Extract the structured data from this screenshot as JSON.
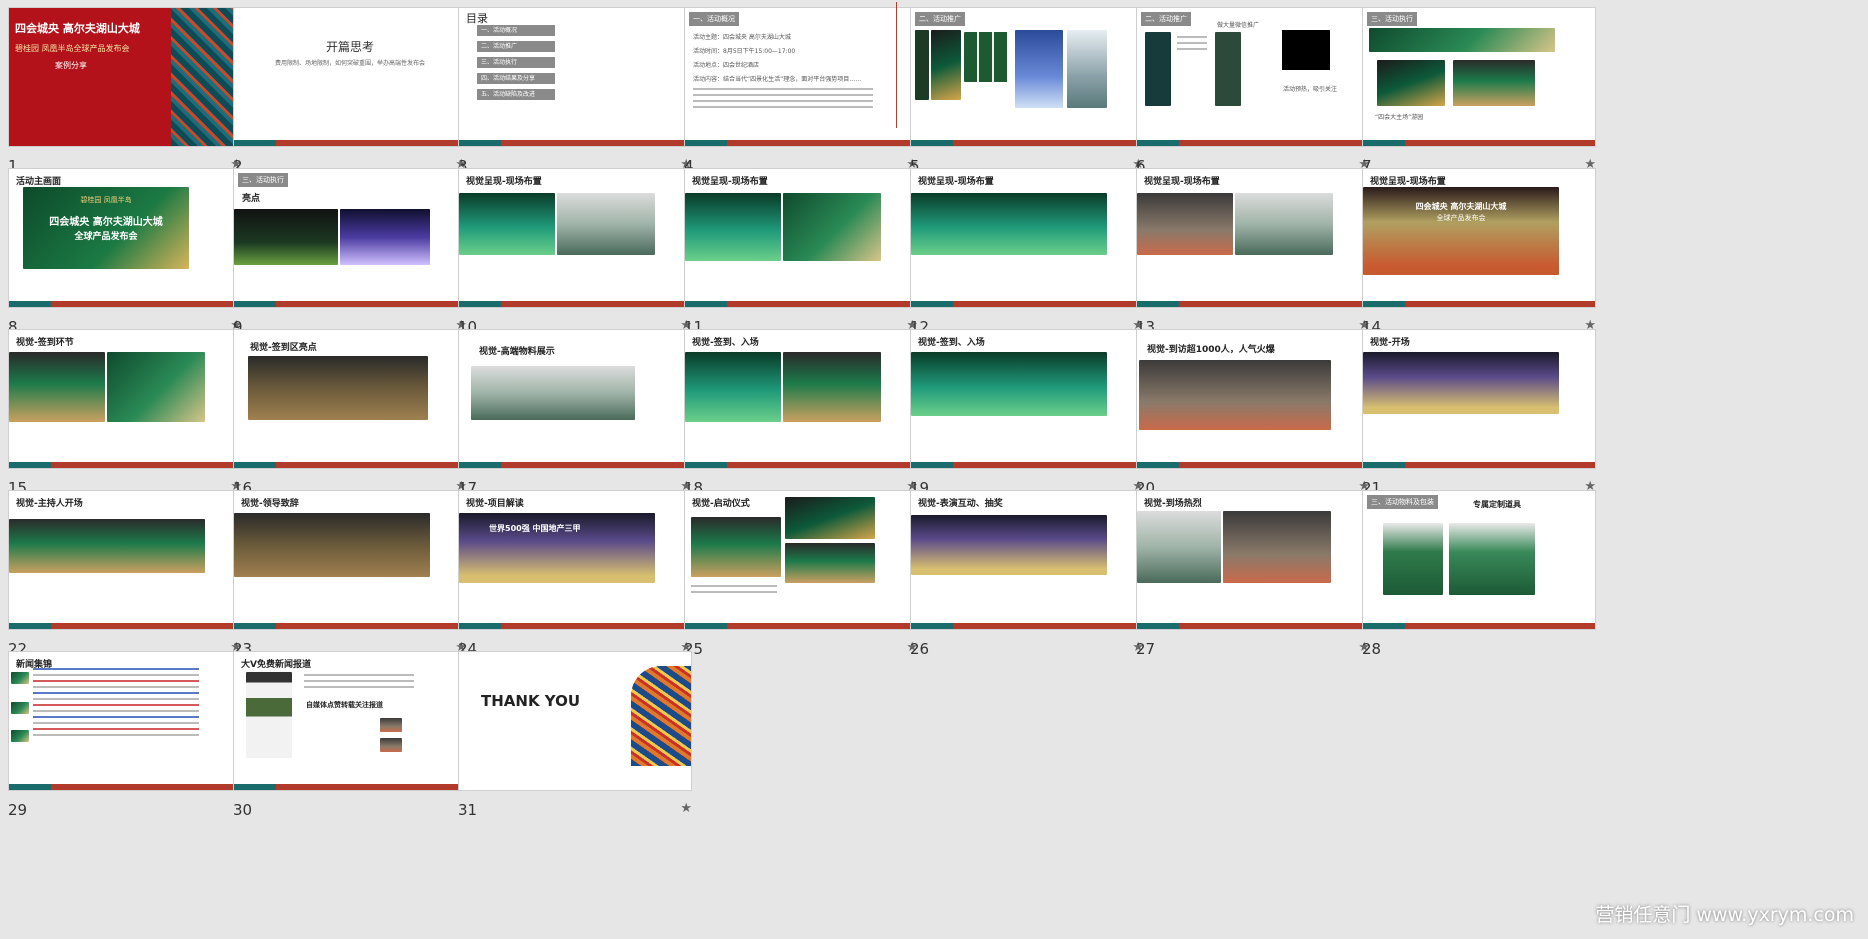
{
  "slides": [
    {
      "num": "1",
      "lines": [
        "四会城央 高尔夫湖山大城",
        "碧桂园 凤凰半岛全球产品发布会",
        "案例分享"
      ]
    },
    {
      "num": "2",
      "title": "开篇思考",
      "subtitle": "费用限制、场地限制，如何突破重围，举办高端性发布会"
    },
    {
      "num": "3",
      "title": "目录",
      "toc": [
        "一、活动概况",
        "二、活动推广",
        "三、活动执行",
        "四、活动结果及分享",
        "五、活动缺陷及改进"
      ]
    },
    {
      "num": "4",
      "label": "一、活动概况",
      "rows": [
        "活动主题：四会城央 高尔夫湖山大城",
        "活动时间：8月5日下午15:00—17:00",
        "活动地点：四会世纪酒店",
        "活动内容：结合当代“四景化生活”理念，面对平台强势项目……"
      ]
    },
    {
      "num": "5",
      "label": "二、活动推广"
    },
    {
      "num": "6",
      "label": "二、活动推广",
      "note": "做大量微信推广",
      "footer": "活动预热，吸引关注"
    },
    {
      "num": "7",
      "label": "三、活动执行",
      "footer": "“四会大主场”游园"
    },
    {
      "num": "8",
      "title": "活动主画面",
      "lines": [
        "碧桂园 凤凰半岛",
        "四会城央 高尔夫湖山大城",
        "全球产品发布会"
      ]
    },
    {
      "num": "9",
      "label": "三、活动执行",
      "title": "亮点"
    },
    {
      "num": "10",
      "title": "视觉呈现-现场布置"
    },
    {
      "num": "11",
      "title": "视觉呈现-现场布置"
    },
    {
      "num": "12",
      "title": "视觉呈现-现场布置"
    },
    {
      "num": "13",
      "title": "视觉呈现-现场布置"
    },
    {
      "num": "14",
      "title": "视觉呈现-现场布置",
      "lines": [
        "四会城央 高尔夫湖山大城",
        "全球产品发布会"
      ]
    },
    {
      "num": "15",
      "title": "视觉-签到环节"
    },
    {
      "num": "16",
      "title": "视觉-签到区亮点"
    },
    {
      "num": "17",
      "title": "视觉-高端物料展示"
    },
    {
      "num": "18",
      "title": "视觉-签到、入场"
    },
    {
      "num": "19",
      "title": "视觉-签到、入场"
    },
    {
      "num": "20",
      "title": "视觉-到访超1000人，人气火爆"
    },
    {
      "num": "21",
      "title": "视觉-开场"
    },
    {
      "num": "22",
      "title": "视觉-主持人开场"
    },
    {
      "num": "23",
      "title": "视觉-领导致辞"
    },
    {
      "num": "24",
      "title": "视觉-项目解读",
      "lines": [
        "世界500强 中国地产三甲"
      ]
    },
    {
      "num": "25",
      "title": "视觉-启动仪式"
    },
    {
      "num": "26",
      "title": "视觉-表演互动、抽奖"
    },
    {
      "num": "27",
      "title": "视觉-到场热烈"
    },
    {
      "num": "28",
      "label": "三、活动物料及包装",
      "title": "专属定制道具"
    },
    {
      "num": "29",
      "title": "新闻集锦"
    },
    {
      "num": "30",
      "title": "大V免费新闻报道",
      "subtitle": "自媒体点赞转载关注报道"
    },
    {
      "num": "31",
      "title": "THANK YOU"
    }
  ],
  "star_glyph": "★",
  "watermark": "营销任意门 www.yxrym.com"
}
